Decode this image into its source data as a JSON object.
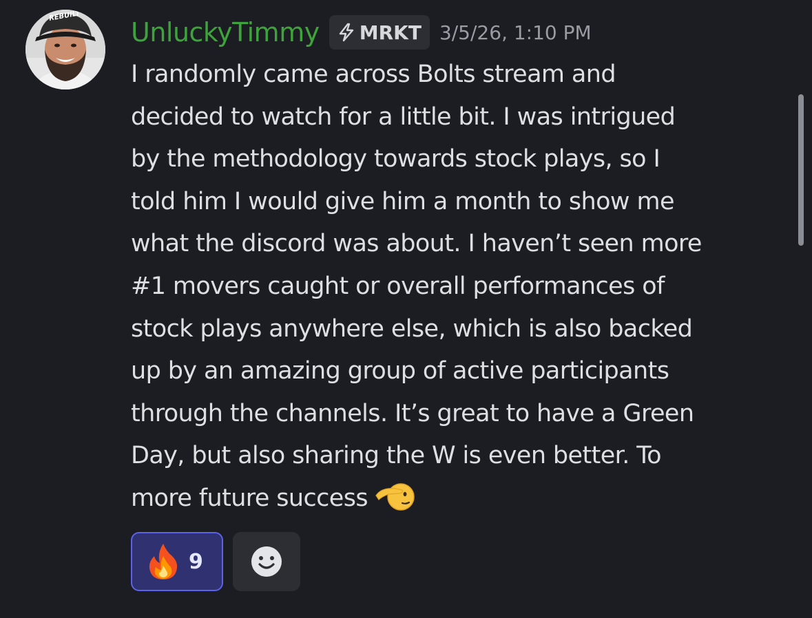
{
  "message": {
    "author": {
      "username": "UnluckyTimmy",
      "name_color": "#3ea33b",
      "avatar": "profile-photo",
      "avatar_cap_text": "REBUILT"
    },
    "tag": {
      "icon": "lightning-bolt-icon",
      "label": "MRKT"
    },
    "timestamp": "3/5/26, 1:10 PM",
    "lines": [
      "I randomly came across Bolts stream and",
      "decided to watch for a little bit. I was intrigued",
      "by the methodology towards stock plays, so I",
      "told him I would give him a month to show me",
      "what the discord was about. I haven’t seen more",
      "#1 movers caught or overall performances of",
      "stock plays anywhere else, which is also backed",
      "up by an amazing group of active participants",
      "through the channels. It’s great to have a Green",
      "Day, but also sharing the W is even better. To",
      "more future success"
    ],
    "trailing_emoji": "saluting-face-emoji",
    "reactions": [
      {
        "emoji": "fire-emoji",
        "count": "9",
        "selected": true
      }
    ],
    "add_reaction_icon": "smiley-face-icon"
  },
  "colors": {
    "background": "#1c1d22",
    "reaction_selected_bg": "#2f3170",
    "reaction_selected_border": "#5b63e8"
  }
}
